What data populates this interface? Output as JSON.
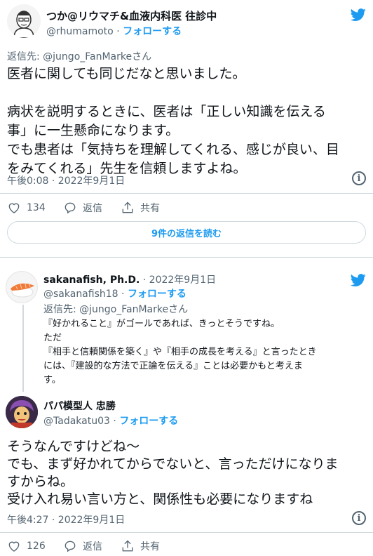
{
  "tweet1": {
    "display_name": "つか@リウマチ&血液内科医 往診中",
    "handle": "@rhumamoto",
    "dot": "·",
    "follow": "フォローする",
    "reply_to": "返信先: @jungo_FanMarkeさん",
    "body_line1": "医者に関しても同じだなと思いました。",
    "body_line2": "病状を説明するときに、医者は「正しい知識を伝える",
    "body_line3": "事」に一生懸命になります。",
    "body_line4": "でも患者は「気持ちを理解してくれる、感じが良い、目",
    "body_line5": "をみてくれる」先生を信頼しますよね。",
    "timestamp": "午後0:08 · 2022年9月1日",
    "like_count": "134",
    "reply_label": "返信",
    "share_label": "共有",
    "read_replies": "9件の返信を読む"
  },
  "tweet2": {
    "display_name": "sakanafish, Ph.D.",
    "date": "· 2022年9月1日",
    "handle": "@sakanafish18",
    "dot": "·",
    "follow": "フォローする",
    "reply_to": "返信先: @jungo_FanMarkeさん",
    "body_line1": "『好かれること』がゴールであれば、きっとそうですね。",
    "body_line2": "ただ",
    "body_line3": "『相手と信頼関係を築く』や『相手の成長を考える』と言ったとき",
    "body_line4": "には、『建設的な方法で正論を伝える』ことは必要かもと考えま",
    "body_line5": "す。"
  },
  "tweet3": {
    "display_name": "パパ模型人 忠勝",
    "handle": "@Tadakatu03",
    "dot": "·",
    "follow": "フォローする",
    "body_line1": "そうなんですけどね〜",
    "body_line2": "でも、まず好かれてからでないと、言っただけになりま",
    "body_line3": "すからね。",
    "body_line4": "受け入れ易い言い方と、関係性も必要になりますね",
    "timestamp": "午後4:27 · 2022年9月1日",
    "like_count": "126",
    "reply_label": "返信",
    "share_label": "共有"
  },
  "info_glyph": "i",
  "colors": {
    "accent": "#1d9bf0",
    "muted": "#536471",
    "text": "#0f1419",
    "border": "#cfd9de"
  }
}
